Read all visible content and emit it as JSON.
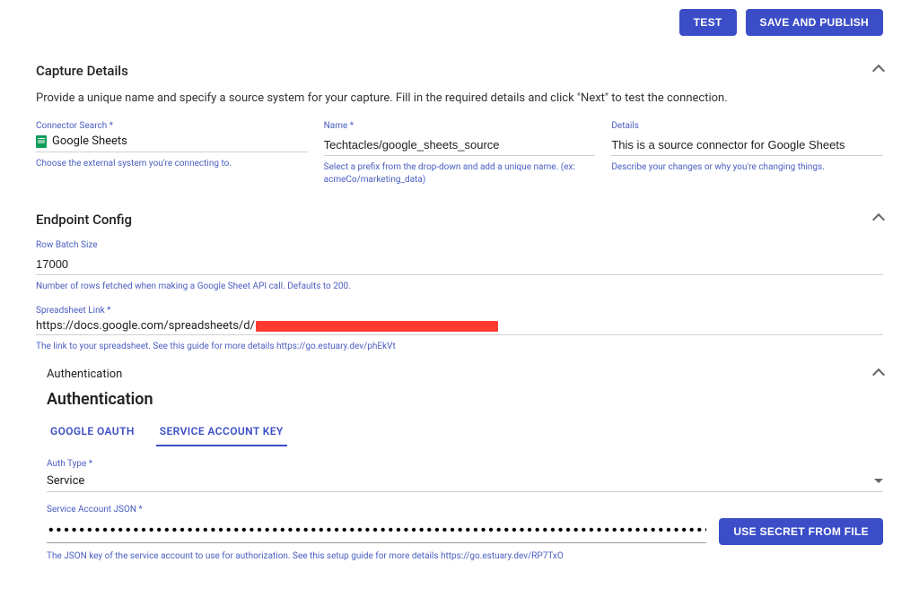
{
  "buttons": {
    "test": "TEST",
    "save": "SAVE AND PUBLISH",
    "secret_file": "USE SECRET FROM FILE"
  },
  "capture": {
    "title": "Capture Details",
    "intro": "Provide a unique name and specify a source system for your capture. Fill in the required details and click \"Next\" to test the connection.",
    "connector": {
      "label": "Connector Search *",
      "value": "Google Sheets",
      "help": "Choose the external system you're connecting to."
    },
    "name": {
      "label": "Name *",
      "value": "Techtacles/google_sheets_source",
      "help": "Select a prefix from the drop-down and add a unique name. (ex: acmeCo/marketing_data)"
    },
    "details": {
      "label": "Details",
      "value": "This is a source connector for Google Sheets",
      "help": "Describe your changes or why you're changing things."
    }
  },
  "endpoint": {
    "title": "Endpoint Config",
    "row_batch": {
      "label": "Row Batch Size",
      "value": "17000",
      "help": "Number of rows fetched when making a Google Sheet API call. Defaults to 200."
    },
    "link": {
      "label": "Spreadsheet Link *",
      "prefix": "https://docs.google.com/spreadsheets/d/",
      "help": "The link to your spreadsheet. See this guide for more details https://go.estuary.dev/phEkVt"
    }
  },
  "auth": {
    "sub_title": "Authentication",
    "heading": "Authentication",
    "tabs": {
      "oauth": "GOOGLE OAUTH",
      "svc": "SERVICE ACCOUNT KEY"
    },
    "type": {
      "label": "Auth Type *",
      "value": "Service"
    },
    "json": {
      "label": "Service Account JSON *",
      "value": "••••••••••••••••••••••••••••••••••••••••••••••••••••••••••••••••••••••••••••••••••••••••••••••••••••••••••••••••••••••••••••••••••••••••••••••••••••••••••••••••••••••••••••••••••••••••••••••••••",
      "help": "The JSON key of the service account to use for authorization. See this setup guide for more details https://go.estuary.dev/RP7TxO"
    }
  }
}
